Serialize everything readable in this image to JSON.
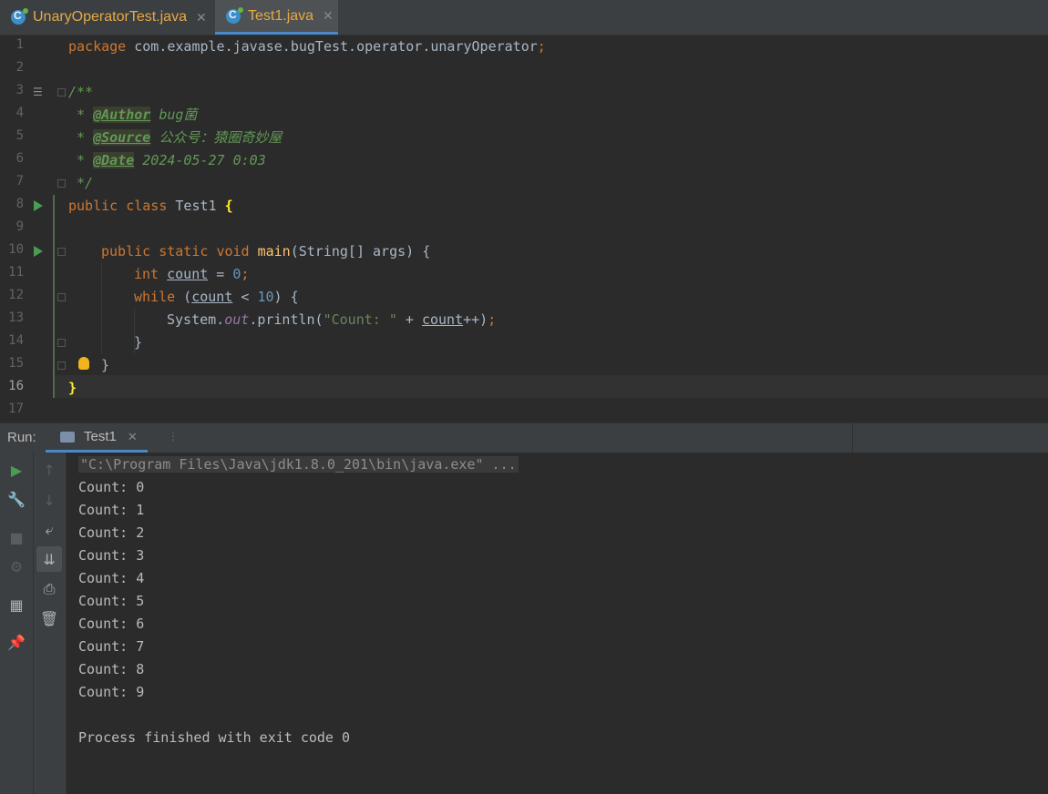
{
  "tabs": [
    {
      "label": "UnaryOperatorTest.java",
      "active": false
    },
    {
      "label": "Test1.java",
      "active": true
    }
  ],
  "editor": {
    "line_numbers": [
      "1",
      "2",
      "3",
      "4",
      "5",
      "6",
      "7",
      "8",
      "9",
      "10",
      "11",
      "12",
      "13",
      "14",
      "15",
      "16",
      "17"
    ],
    "package_kw": "package",
    "package_name": " com.example.javase.bugTest.operator.unaryOperator",
    "semicolon": ";",
    "doc_open": "/**",
    "doc_star": " * ",
    "author_tag": "@Author",
    "author_val": " bug菌",
    "source_tag": "@Source",
    "source_val": " 公众号：猿圈奇妙屋",
    "date_tag": "@Date",
    "date_val": " 2024-05-27 0:03",
    "doc_close": " */",
    "public": "public",
    "class": "class",
    "class_name": " Test1 ",
    "open_brace": "{",
    "static": "static",
    "void": "void",
    "main": "main",
    "main_args": "(String[] args) {",
    "int": "int",
    "count": "count",
    "assign": " = ",
    "zero": "0",
    "while": "while",
    "paren_open": " (",
    "lt": " < ",
    "ten": "10",
    "paren_close": ") {",
    "system": "System.",
    "out": "out",
    "println": ".println(",
    "count_str": "\"Count: \"",
    "plus": " + ",
    "incr": "++)",
    "close_brace": "}"
  },
  "run_panel": {
    "label": "Run:",
    "tab": "Test1",
    "cmd": "\"C:\\Program Files\\Java\\jdk1.8.0_201\\bin\\java.exe\" ...",
    "output": [
      "Count: 0",
      "Count: 1",
      "Count: 2",
      "Count: 3",
      "Count: 4",
      "Count: 5",
      "Count: 6",
      "Count: 7",
      "Count: 8",
      "Count: 9"
    ],
    "finish": "Process finished with exit code 0"
  }
}
